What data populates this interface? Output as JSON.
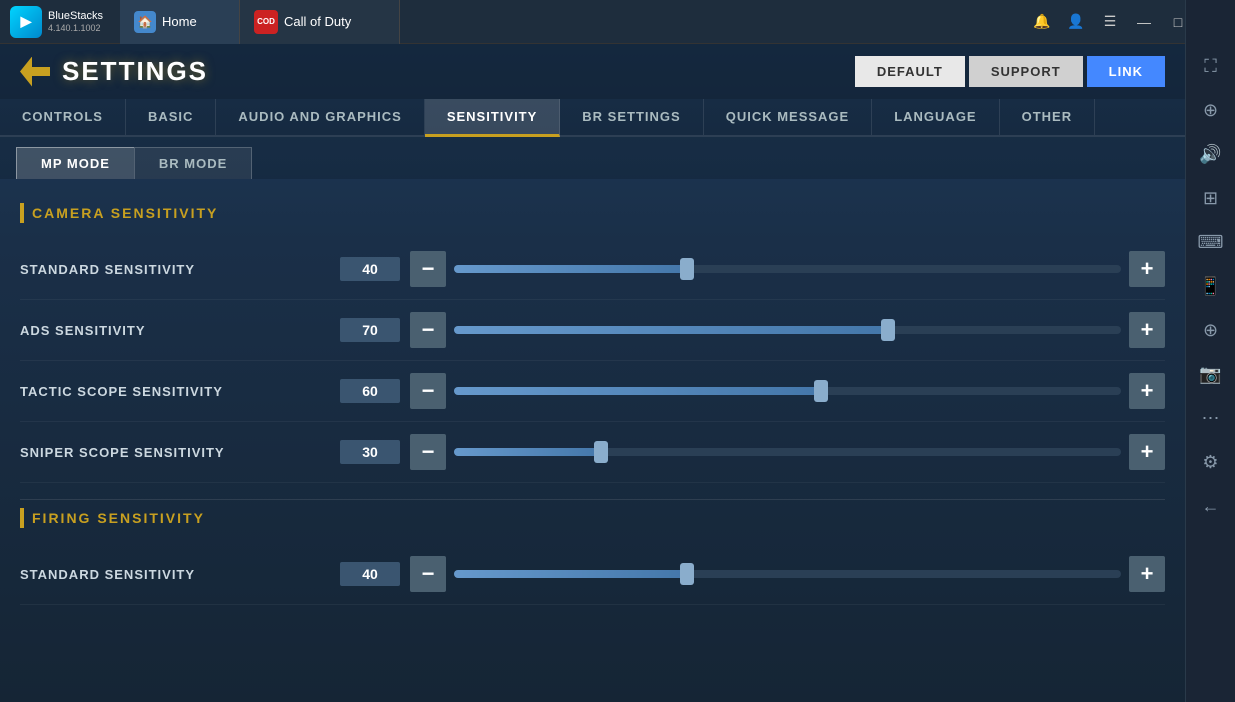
{
  "titlebar": {
    "bluestacks_name": "BlueStacks",
    "bluestacks_version": "4.140.1.1002",
    "home_tab": "Home",
    "game_tab": "Call of Duty",
    "win_minimize": "—",
    "win_maximize": "□",
    "win_close": "✕"
  },
  "header": {
    "title": "SETTINGS",
    "back_label": "←",
    "default_btn": "DEFAULT",
    "support_btn": "SUPPORT",
    "link_btn": "LINK"
  },
  "main_tabs": [
    {
      "label": "CONTROLS"
    },
    {
      "label": "BASIC"
    },
    {
      "label": "AUDIO AND GRAPHICS"
    },
    {
      "label": "SENSITIVITY",
      "active": true
    },
    {
      "label": "BR SETTINGS"
    },
    {
      "label": "QUICK MESSAGE"
    },
    {
      "label": "LANGUAGE"
    },
    {
      "label": "OTHER"
    }
  ],
  "mode_tabs": [
    {
      "label": "MP MODE",
      "active": true
    },
    {
      "label": "BR MODE"
    }
  ],
  "camera_section": {
    "title": "CAMERA SENSITIVITY",
    "rows": [
      {
        "label": "STANDARD SENSITIVITY",
        "value": "40",
        "fill_pct": 35
      },
      {
        "label": "ADS SENSITIVITY",
        "value": "70",
        "fill_pct": 65
      },
      {
        "label": "TACTIC SCOPE SENSITIVITY",
        "value": "60",
        "fill_pct": 55
      },
      {
        "label": "SNIPER SCOPE SENSITIVITY",
        "value": "30",
        "fill_pct": 22
      }
    ]
  },
  "firing_section": {
    "title": "FIRING SENSITIVITY",
    "rows": [
      {
        "label": "STANDARD SENSITIVITY",
        "value": "40",
        "fill_pct": 35
      }
    ]
  },
  "sidebar_icons": [
    "⛶",
    "⊕",
    "⌨",
    "📱",
    "🔧",
    "📷",
    "⋯",
    "⚙",
    "←"
  ]
}
